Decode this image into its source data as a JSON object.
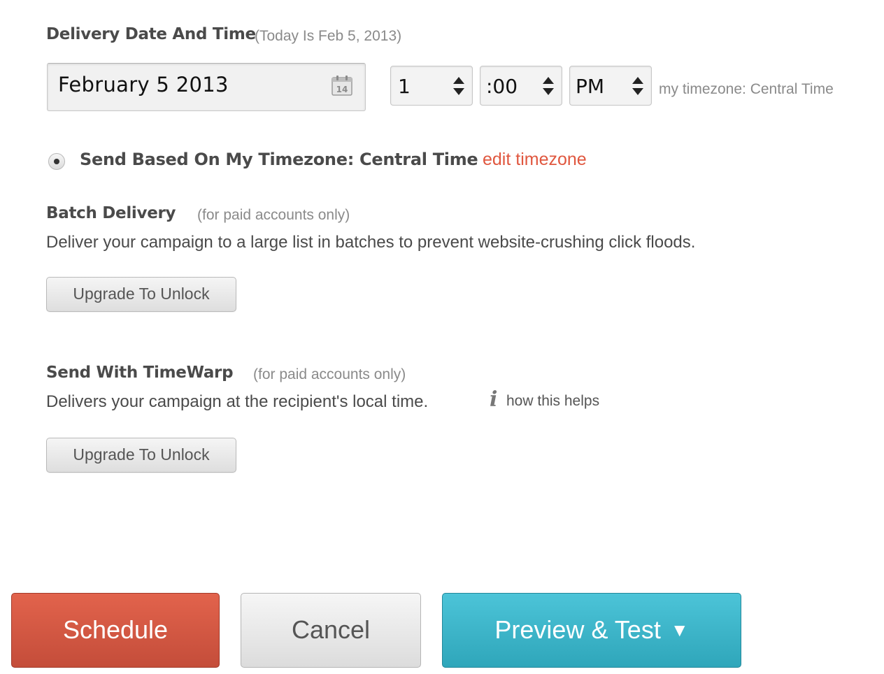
{
  "delivery": {
    "title": "Delivery Date And Time",
    "today_note": "(Today Is Feb 5, 2013)",
    "date_value": "February 5 2013",
    "calendar_day": "14",
    "hour": "1",
    "minute": ":00",
    "ampm": "PM",
    "timezone_note": "my timezone: Central Time"
  },
  "send_option": {
    "label": "Send Based On My Timezone: Central Time",
    "selected": true,
    "edit_link": "edit timezone"
  },
  "batch": {
    "title": "Batch Delivery",
    "note": "(for paid accounts only)",
    "description": "Deliver your campaign to a large list in batches to prevent website-crushing click floods.",
    "button": "Upgrade To Unlock"
  },
  "timewarp": {
    "title": "Send With TimeWarp",
    "note": "(for paid accounts only)",
    "description": "Delivers your campaign at the recipient's local time.",
    "info_glyph": "i",
    "help_link": "how this helps",
    "button": "Upgrade To Unlock"
  },
  "actions": {
    "schedule": "Schedule",
    "cancel": "Cancel",
    "preview": "Preview & Test",
    "preview_caret": "▼"
  },
  "colors": {
    "accent_red": "#e0573f",
    "preview_blue": "#3db5c9"
  }
}
